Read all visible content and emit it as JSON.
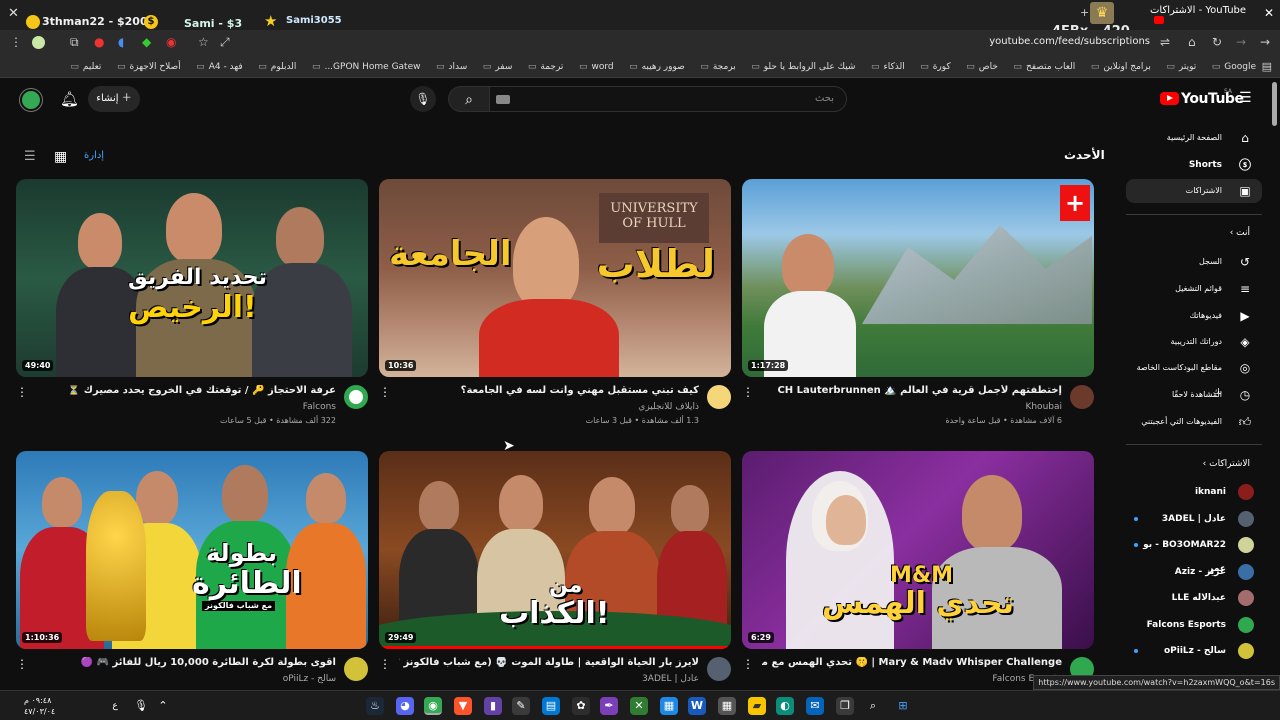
{
  "browser": {
    "donations": [
      {
        "text": "3thman22 - $200"
      },
      {
        "text": "Sami - $3"
      },
      {
        "text": "Sami3055"
      }
    ],
    "tab_title": "الاشتراكات - YouTube",
    "score": "4EBx - 420",
    "url": "youtube.com/feed/subscriptions",
    "bookmarks": [
      "Google",
      "تويتر",
      "برامج اونلاين",
      "العاب متصفح",
      "خاص",
      "كورة",
      "الذكاء",
      "شيك على الروابط يا حلو",
      "برمجة",
      "صوور رهيبه",
      "word",
      "ترجمة",
      "سفر",
      "سداد",
      "GPON Home Gatew...",
      "الدبلوم",
      "فهد - A4",
      "أصلاح الاجهزة",
      "تعليم"
    ]
  },
  "header": {
    "create_label": "إنشاء",
    "search_placeholder": "بحث",
    "logo_text": "YouTube",
    "country": "SA"
  },
  "content": {
    "heading": "الأحدث",
    "manage_label": "إدارة"
  },
  "videos": [
    {
      "title": "إختطفتهم لأجمل قرية في العالم 🏔️ CH Lauterbrunnen",
      "channel": "Khoubai",
      "stats": "6 آلاف مشاهدة • قبل ساعة واحدة",
      "duration": "1:17:28",
      "thumb_text": ""
    },
    {
      "title": "كيف تبني مستقبل مهني وانت لسه في الجامعة؟",
      "channel": "ذايلاف للانجليزي",
      "stats": "1.3 ألف مشاهدة • قبل 3 ساعات",
      "duration": "10:36",
      "thumb_text_1": "لطلاب",
      "thumb_text_2": "الجامعة"
    },
    {
      "title": "عرفة الاحتجاز 🔑 / توقعتك في الخروج يحدد مصيرك ⏳",
      "channel": "Falcons",
      "stats": "322 ألف مشاهدة • قبل 5 ساعات",
      "duration": "49:40",
      "thumb_text_1": "تحديد الفريق",
      "thumb_text_2": "الرخيص!"
    },
    {
      "title": "Mary & Madv Whisper Challenge | 🤫 تحدي الهمس مع ماغي وماري 😂",
      "channel": "Falcons Esports",
      "stats": "",
      "duration": "6:29",
      "thumb_text_1": "M&M",
      "thumb_text_2": "تحدي الهمس"
    },
    {
      "title": "لايرز بار الحياة الواقعية | طاولة الموت 💀 (مع شباب فالكونز 💚)",
      "channel": "عادل | 3ADEL",
      "stats": "",
      "duration": "29:49",
      "thumb_text_1": "من",
      "thumb_text_2": "الكذاب!"
    },
    {
      "title": "اقوى بطولة لكرة الطائرة 10,000 ريال للفائز 🎮 🟣",
      "channel": "سالح - oPiiLz",
      "stats": "",
      "duration": "1:10:36",
      "thumb_text_1": "بطولة",
      "thumb_text_2": "الطائرة",
      "thumb_text_3": "مع شباب فالكونز"
    }
  ],
  "sidebar": {
    "main": [
      {
        "label": "الصفحة الرئيسية",
        "icon": "home-icon"
      },
      {
        "label": "Shorts",
        "icon": "shorts-icon"
      },
      {
        "label": "الاشتراكات",
        "icon": "subscriptions-icon"
      }
    ],
    "you_heading": "أنت",
    "you": [
      {
        "label": "السجل",
        "icon": "history-icon"
      },
      {
        "label": "قوائم التشغيل",
        "icon": "playlists-icon"
      },
      {
        "label": "فيديوهاتك",
        "icon": "your-videos-icon"
      },
      {
        "label": "دوراتك التدريبية",
        "icon": "courses-icon"
      },
      {
        "label": "مقاطع البودكاست الخاصة بك",
        "icon": "podcasts-icon"
      },
      {
        "label": "المشاهدة لاحقًا",
        "icon": "watch-later-icon"
      },
      {
        "label": "الفيديوهات التي أعجبتني",
        "icon": "liked-icon"
      }
    ],
    "subs_heading": "الاشتراكات",
    "subscriptions": [
      {
        "name": "iknani",
        "color": "#8b1d1d",
        "dot": false
      },
      {
        "name": "عادل | 3ADEL",
        "color": "#556070",
        "dot": true
      },
      {
        "name": "BO3OMAR22 - بو عمر",
        "color": "#cfd59a",
        "dot": true
      },
      {
        "name": "عزيز - Aziz",
        "color": "#3a6ea5",
        "dot": false
      },
      {
        "name": "عبدالاله LLE",
        "color": "#a36d6d",
        "dot": false
      },
      {
        "name": "Falcons Esports",
        "color": "#2fa84f",
        "dot": false
      },
      {
        "name": "سالح - oPiiLz",
        "color": "#d1c23a",
        "dot": true
      }
    ]
  },
  "status_url": "https://www.youtube.com/watch?v=h2zaxmWQQ_o&t=16s",
  "clock": {
    "time": "٠٩:٤٨ م",
    "date": "٤٧/٠٣/٠٤"
  },
  "colors": {
    "accent": "#ff0000",
    "link": "#3ea6ff",
    "bg": "#0f0f0f"
  }
}
